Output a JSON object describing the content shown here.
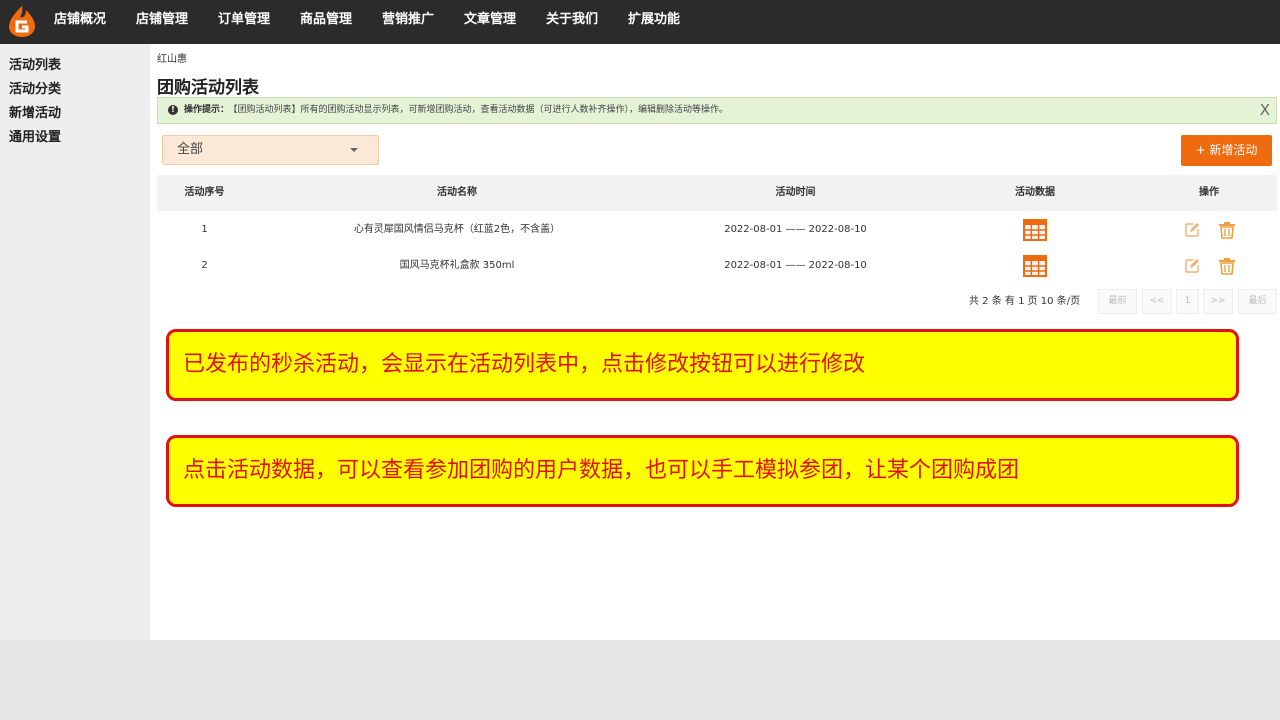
{
  "topnav": {
    "items": [
      "店铺概况",
      "店铺管理",
      "订单管理",
      "商品管理",
      "营销推广",
      "文章管理",
      "关于我们",
      "扩展功能"
    ]
  },
  "sidebar": {
    "items": [
      "活动列表",
      "活动分类",
      "新增活动",
      "通用设置"
    ]
  },
  "main": {
    "breadcrumb": "红山惠",
    "title": "团购活动列表",
    "tip": {
      "label": "操作提示：",
      "text": "【团购活动列表】所有的团购活动显示列表，可新增团购活动，查看活动数据（可进行人数补齐操作），编辑删除活动等操作。",
      "close": "X"
    },
    "filter": {
      "selected": "全部"
    },
    "add_button": "+ 新增活动",
    "table": {
      "headers": [
        "活动序号",
        "活动名称",
        "活动时间",
        "活动数据",
        "操作"
      ],
      "rows": [
        {
          "id": "1",
          "name": "心有灵犀国风情侣马克杯（红蓝2色，不含盖）",
          "time": "2022-08-01 —— 2022-08-10"
        },
        {
          "id": "2",
          "name": "国风马克杯礼盒款 350ml",
          "time": "2022-08-01 —— 2022-08-10"
        }
      ]
    },
    "pager": {
      "info": "共 2 条 有 1 页 10 条/页",
      "first": "最前",
      "prev": "<<",
      "page": "1",
      "next": ">>",
      "last": "最后"
    }
  },
  "callouts": [
    "已发布的秒杀活动，会显示在活动列表中，点击修改按钮可以进行修改",
    "点击活动数据，可以查看参加团购的用户数据，也可以手工模拟参团，让某个团购成团"
  ],
  "colors": {
    "accent": "#f06a0e",
    "topbar": "#2b2b2b",
    "callout_bg": "#ffff00",
    "callout_text": "#e41010"
  },
  "icons": {
    "logo": "brand-logo-icon",
    "data": "table-grid-icon",
    "edit": "edit-icon",
    "delete": "trash-icon",
    "info": "info-icon"
  }
}
